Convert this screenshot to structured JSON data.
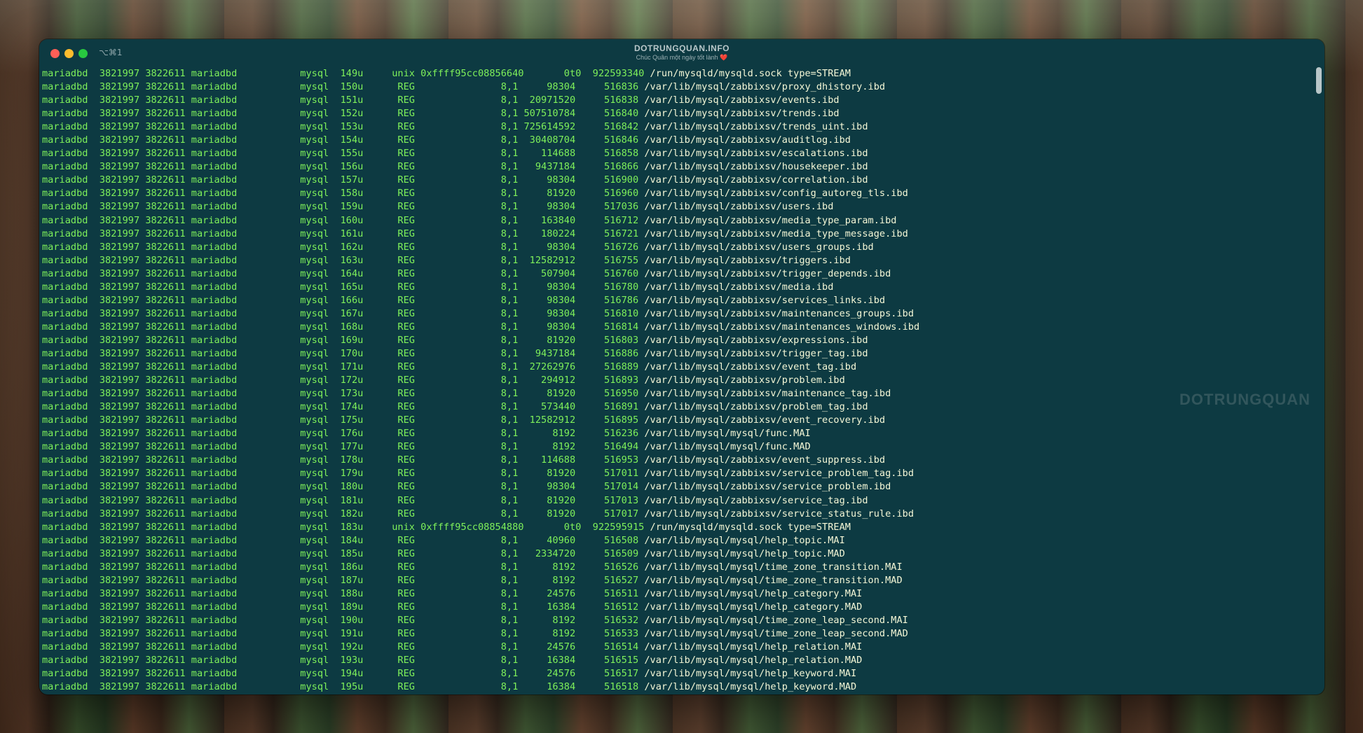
{
  "window": {
    "shortcut": "⌥⌘1",
    "title": "DOTRUNGQUAN.INFO",
    "subtitle": "Chúc Quân một ngày tốt lành",
    "heart": "❤️",
    "watermark": "DOTRUNGQUAN"
  },
  "terminal": {
    "lines": [
      [
        "mariadbd  3821997 3822611 mariadbd           mysql  149u     unix 0xffff95cc08856640       0t0  922593340 ",
        "/run/mysqld/mysqld.sock type=STREAM"
      ],
      [
        "mariadbd  3821997 3822611 mariadbd           mysql  150u      REG               8,1     98304     516836 ",
        "/var/lib/mysql/zabbixsv/proxy_dhistory.ibd"
      ],
      [
        "mariadbd  3821997 3822611 mariadbd           mysql  151u      REG               8,1  20971520     516838 ",
        "/var/lib/mysql/zabbixsv/events.ibd"
      ],
      [
        "mariadbd  3821997 3822611 mariadbd           mysql  152u      REG               8,1 507510784     516840 ",
        "/var/lib/mysql/zabbixsv/trends.ibd"
      ],
      [
        "mariadbd  3821997 3822611 mariadbd           mysql  153u      REG               8,1 725614592     516842 ",
        "/var/lib/mysql/zabbixsv/trends_uint.ibd"
      ],
      [
        "mariadbd  3821997 3822611 mariadbd           mysql  154u      REG               8,1  30408704     516846 ",
        "/var/lib/mysql/zabbixsv/auditlog.ibd"
      ],
      [
        "mariadbd  3821997 3822611 mariadbd           mysql  155u      REG               8,1    114688     516858 ",
        "/var/lib/mysql/zabbixsv/escalations.ibd"
      ],
      [
        "mariadbd  3821997 3822611 mariadbd           mysql  156u      REG               8,1   9437184     516866 ",
        "/var/lib/mysql/zabbixsv/housekeeper.ibd"
      ],
      [
        "mariadbd  3821997 3822611 mariadbd           mysql  157u      REG               8,1     98304     516900 ",
        "/var/lib/mysql/zabbixsv/correlation.ibd"
      ],
      [
        "mariadbd  3821997 3822611 mariadbd           mysql  158u      REG               8,1     81920     516960 ",
        "/var/lib/mysql/zabbixsv/config_autoreg_tls.ibd"
      ],
      [
        "mariadbd  3821997 3822611 mariadbd           mysql  159u      REG               8,1     98304     517036 ",
        "/var/lib/mysql/zabbixsv/users.ibd"
      ],
      [
        "mariadbd  3821997 3822611 mariadbd           mysql  160u      REG               8,1    163840     516712 ",
        "/var/lib/mysql/zabbixsv/media_type_param.ibd"
      ],
      [
        "mariadbd  3821997 3822611 mariadbd           mysql  161u      REG               8,1    180224     516721 ",
        "/var/lib/mysql/zabbixsv/media_type_message.ibd"
      ],
      [
        "mariadbd  3821997 3822611 mariadbd           mysql  162u      REG               8,1     98304     516726 ",
        "/var/lib/mysql/zabbixsv/users_groups.ibd"
      ],
      [
        "mariadbd  3821997 3822611 mariadbd           mysql  163u      REG               8,1  12582912     516755 ",
        "/var/lib/mysql/zabbixsv/triggers.ibd"
      ],
      [
        "mariadbd  3821997 3822611 mariadbd           mysql  164u      REG               8,1    507904     516760 ",
        "/var/lib/mysql/zabbixsv/trigger_depends.ibd"
      ],
      [
        "mariadbd  3821997 3822611 mariadbd           mysql  165u      REG               8,1     98304     516780 ",
        "/var/lib/mysql/zabbixsv/media.ibd"
      ],
      [
        "mariadbd  3821997 3822611 mariadbd           mysql  166u      REG               8,1     98304     516786 ",
        "/var/lib/mysql/zabbixsv/services_links.ibd"
      ],
      [
        "mariadbd  3821997 3822611 mariadbd           mysql  167u      REG               8,1     98304     516810 ",
        "/var/lib/mysql/zabbixsv/maintenances_groups.ibd"
      ],
      [
        "mariadbd  3821997 3822611 mariadbd           mysql  168u      REG               8,1     98304     516814 ",
        "/var/lib/mysql/zabbixsv/maintenances_windows.ibd"
      ],
      [
        "mariadbd  3821997 3822611 mariadbd           mysql  169u      REG               8,1     81920     516803 ",
        "/var/lib/mysql/zabbixsv/expressions.ibd"
      ],
      [
        "mariadbd  3821997 3822611 mariadbd           mysql  170u      REG               8,1   9437184     516886 ",
        "/var/lib/mysql/zabbixsv/trigger_tag.ibd"
      ],
      [
        "mariadbd  3821997 3822611 mariadbd           mysql  171u      REG               8,1  27262976     516889 ",
        "/var/lib/mysql/zabbixsv/event_tag.ibd"
      ],
      [
        "mariadbd  3821997 3822611 mariadbd           mysql  172u      REG               8,1    294912     516893 ",
        "/var/lib/mysql/zabbixsv/problem.ibd"
      ],
      [
        "mariadbd  3821997 3822611 mariadbd           mysql  173u      REG               8,1     81920     516950 ",
        "/var/lib/mysql/zabbixsv/maintenance_tag.ibd"
      ],
      [
        "mariadbd  3821997 3822611 mariadbd           mysql  174u      REG               8,1    573440     516891 ",
        "/var/lib/mysql/zabbixsv/problem_tag.ibd"
      ],
      [
        "mariadbd  3821997 3822611 mariadbd           mysql  175u      REG               8,1  12582912     516895 ",
        "/var/lib/mysql/zabbixsv/event_recovery.ibd"
      ],
      [
        "mariadbd  3821997 3822611 mariadbd           mysql  176u      REG               8,1      8192     516236 ",
        "/var/lib/mysql/mysql/func.MAI"
      ],
      [
        "mariadbd  3821997 3822611 mariadbd           mysql  177u      REG               8,1      8192     516494 ",
        "/var/lib/mysql/mysql/func.MAD"
      ],
      [
        "mariadbd  3821997 3822611 mariadbd           mysql  178u      REG               8,1    114688     516953 ",
        "/var/lib/mysql/zabbixsv/event_suppress.ibd"
      ],
      [
        "mariadbd  3821997 3822611 mariadbd           mysql  179u      REG               8,1     81920     517011 ",
        "/var/lib/mysql/zabbixsv/service_problem_tag.ibd"
      ],
      [
        "mariadbd  3821997 3822611 mariadbd           mysql  180u      REG               8,1     98304     517014 ",
        "/var/lib/mysql/zabbixsv/service_problem.ibd"
      ],
      [
        "mariadbd  3821997 3822611 mariadbd           mysql  181u      REG               8,1     81920     517013 ",
        "/var/lib/mysql/zabbixsv/service_tag.ibd"
      ],
      [
        "mariadbd  3821997 3822611 mariadbd           mysql  182u      REG               8,1     81920     517017 ",
        "/var/lib/mysql/zabbixsv/service_status_rule.ibd"
      ],
      [
        "mariadbd  3821997 3822611 mariadbd           mysql  183u     unix 0xffff95cc08854880       0t0  922595915 ",
        "/run/mysqld/mysqld.sock type=STREAM"
      ],
      [
        "mariadbd  3821997 3822611 mariadbd           mysql  184u      REG               8,1     40960     516508 ",
        "/var/lib/mysql/mysql/help_topic.MAI"
      ],
      [
        "mariadbd  3821997 3822611 mariadbd           mysql  185u      REG               8,1   2334720     516509 ",
        "/var/lib/mysql/mysql/help_topic.MAD"
      ],
      [
        "mariadbd  3821997 3822611 mariadbd           mysql  186u      REG               8,1      8192     516526 ",
        "/var/lib/mysql/mysql/time_zone_transition.MAI"
      ],
      [
        "mariadbd  3821997 3822611 mariadbd           mysql  187u      REG               8,1      8192     516527 ",
        "/var/lib/mysql/mysql/time_zone_transition.MAD"
      ],
      [
        "mariadbd  3821997 3822611 mariadbd           mysql  188u      REG               8,1     24576     516511 ",
        "/var/lib/mysql/mysql/help_category.MAI"
      ],
      [
        "mariadbd  3821997 3822611 mariadbd           mysql  189u      REG               8,1     16384     516512 ",
        "/var/lib/mysql/mysql/help_category.MAD"
      ],
      [
        "mariadbd  3821997 3822611 mariadbd           mysql  190u      REG               8,1      8192     516532 ",
        "/var/lib/mysql/mysql/time_zone_leap_second.MAI"
      ],
      [
        "mariadbd  3821997 3822611 mariadbd           mysql  191u      REG               8,1      8192     516533 ",
        "/var/lib/mysql/mysql/time_zone_leap_second.MAD"
      ],
      [
        "mariadbd  3821997 3822611 mariadbd           mysql  192u      REG               8,1     24576     516514 ",
        "/var/lib/mysql/mysql/help_relation.MAI"
      ],
      [
        "mariadbd  3821997 3822611 mariadbd           mysql  193u      REG               8,1     16384     516515 ",
        "/var/lib/mysql/mysql/help_relation.MAD"
      ],
      [
        "mariadbd  3821997 3822611 mariadbd           mysql  194u      REG               8,1     24576     516517 ",
        "/var/lib/mysql/mysql/help_keyword.MAI"
      ],
      [
        "mariadbd  3821997 3822611 mariadbd           mysql  195u      REG               8,1     16384     516518 ",
        "/var/lib/mysql/mysql/help_keyword.MAD"
      ]
    ]
  },
  "colors": {
    "background": "#0d3a42",
    "text": "#7ef05a",
    "path": "#f4f7d6"
  }
}
